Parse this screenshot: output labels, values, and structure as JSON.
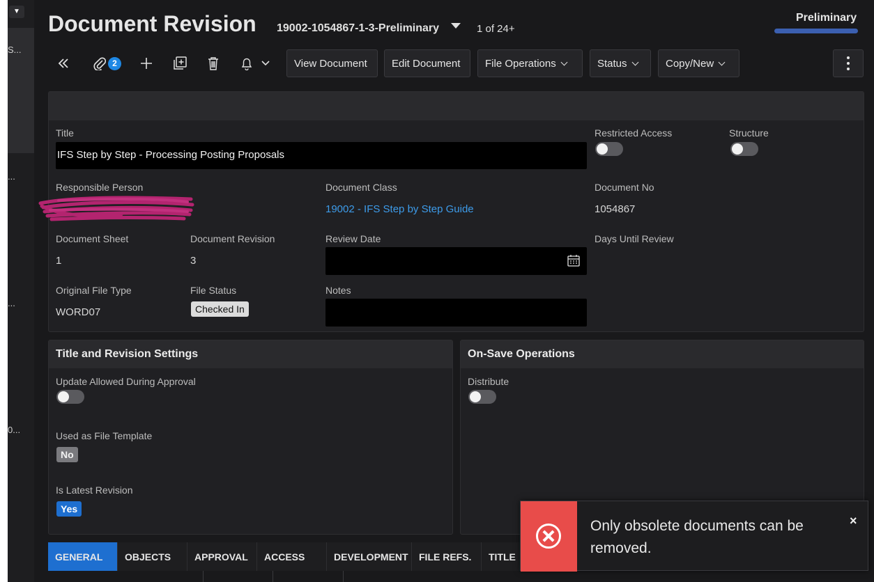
{
  "header": {
    "title": "Document Revision",
    "record_id": "19002-1054867-1-3-Preliminary",
    "record_count": "1 of 24+",
    "state": "Preliminary"
  },
  "toolbar": {
    "attachments_count": "2",
    "view_document": "View Document",
    "edit_document": "Edit Document",
    "file_operations": "File Operations",
    "status": "Status",
    "copy_new": "Copy/New"
  },
  "fields": {
    "title_label": "Title",
    "title_value": "IFS Step by Step - Processing Posting Proposals",
    "restricted_access_label": "Restricted Access",
    "structure_label": "Structure",
    "responsible_person_label": "Responsible Person",
    "document_class_label": "Document Class",
    "document_class_value": "19002 - IFS Step by Step Guide",
    "document_no_label": "Document No",
    "document_no_value": "1054867",
    "document_sheet_label": "Document Sheet",
    "document_sheet_value": "1",
    "document_revision_label": "Document Revision",
    "document_revision_value": "3",
    "review_date_label": "Review Date",
    "days_until_review_label": "Days Until Review",
    "original_file_type_label": "Original File Type",
    "original_file_type_value": "WORD07",
    "file_status_label": "File Status",
    "file_status_value": "Checked In",
    "notes_label": "Notes"
  },
  "title_revision_settings": {
    "heading": "Title and Revision Settings",
    "update_allowed_label": "Update Allowed During Approval",
    "file_template_label": "Used as File Template",
    "file_template_value": "No",
    "latest_revision_label": "Is Latest Revision",
    "latest_revision_value": "Yes"
  },
  "on_save": {
    "heading": "On-Save Operations",
    "distribute_label": "Distribute"
  },
  "tabs": [
    "GENERAL",
    "OBJECTS",
    "APPROVAL",
    "ACCESS",
    "DEVELOPMENT",
    "FILE REFS.",
    "TITLE"
  ],
  "left_rail": [
    "S...",
    "...",
    "...",
    "0..."
  ],
  "toast": {
    "message": "Only obsolete documents can be removed.",
    "close": "×"
  },
  "colors": {
    "accent": "#1e6fd0",
    "link": "#3d9be9",
    "error": "#e84c4a",
    "yes_chip": "#1e6fd0",
    "state_bar": "#3b5fb0"
  }
}
